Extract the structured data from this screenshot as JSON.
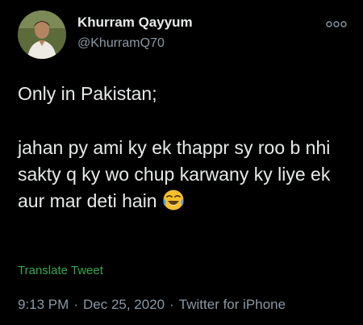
{
  "author": {
    "display_name": "Khurram Qayyum",
    "handle": "@KhurramQ70",
    "avatar_icon": "profile-photo"
  },
  "tweet": {
    "text_line1": "Only in Pakistan;",
    "text_line2": "jahan py ami ky ek thappr sy roo b nhi sakty q ky wo chup karwany ky liye ek aur mar deti hain",
    "emoji_icon": "face-with-tears-of-joy-icon"
  },
  "translate_label": "Translate Tweet",
  "meta": {
    "time": "9:13 PM",
    "date": "Dec 25, 2020",
    "source": "Twitter for iPhone",
    "separator": "·"
  },
  "more_icon": "more-options-icon",
  "colors": {
    "background": "#000000",
    "text": "#e7e9ea",
    "secondary": "#8b98a5",
    "translate": "#33a852"
  }
}
